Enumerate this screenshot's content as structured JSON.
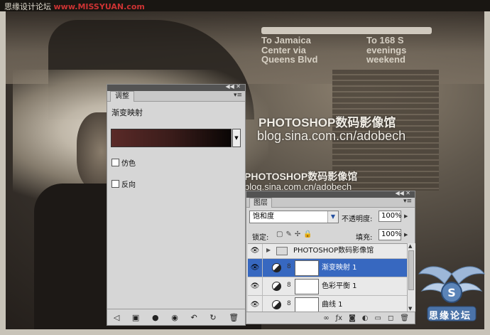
{
  "header": {
    "text_gray": "思缘设计论坛",
    "text_url": "www.MISSYUAN.com"
  },
  "signs": {
    "sign1_line1": "To Jamaica",
    "sign1_line2": "Center via",
    "sign1_line3": "Queens Blvd",
    "sign2_line1": "To 168 S",
    "sign2_line2": "evenings",
    "sign2_line3": "weekend"
  },
  "watermarks": {
    "title_large": "PHOTOSHOP数码影像馆",
    "url_large": "blog.sina.com.cn/adobech",
    "title_small": "PHOTOSHOP数码影像馆",
    "url_small": "blog.sina.com.cn/adobech"
  },
  "adjustments": {
    "tab": "调整",
    "title": "渐变映射",
    "dither_label": "仿色",
    "reverse_label": "反向",
    "gradient_colors": [
      "#5a2a28",
      "#3a1c1a",
      "#0a0605"
    ]
  },
  "layers": {
    "tab": "图层",
    "blend_mode": "饱和度",
    "opacity_label": "不透明度:",
    "opacity_value": "100%",
    "lock_label": "锁定:",
    "fill_label": "填充:",
    "fill_value": "100%",
    "group_name": "PHOTOSHOP数码影像馆",
    "rows": [
      {
        "name": "渐变映射 1"
      },
      {
        "name": "色彩平衡 1"
      },
      {
        "name": "曲线 1"
      }
    ],
    "selected_color": "#3768c0"
  },
  "logo": {
    "text": "思缘论坛"
  }
}
